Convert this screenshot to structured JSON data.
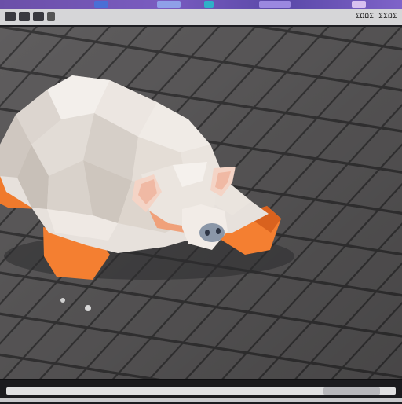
{
  "window": {
    "title_bar": "purple-title-bar"
  },
  "toolbar": {
    "tools": [
      "move-tool",
      "rotate-tool",
      "scale-tool",
      "view-tool"
    ],
    "readout": "ΣΩΩΣ ΣΣΩΣ"
  },
  "viewport": {
    "content": "pig-3d-model",
    "floor": "tiled-grid-floor"
  },
  "timeline": {
    "position": 0.83
  },
  "colors": {
    "accent": "#7a5cc0",
    "model_body": "#e6e0da",
    "model_feet": "#f07a2c",
    "floor_tile": "#5d5b5c",
    "floor_grout": "#3a393b"
  }
}
